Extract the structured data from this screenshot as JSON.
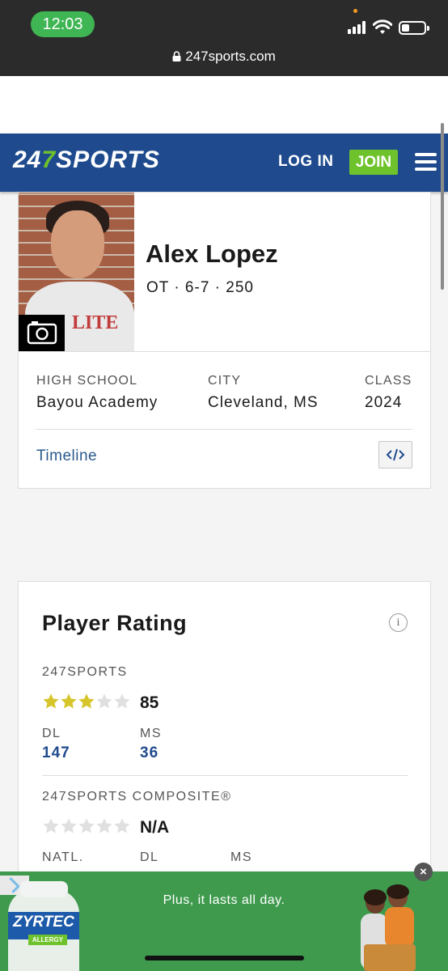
{
  "status_bar": {
    "time": "12:03",
    "url": "247sports.com"
  },
  "header": {
    "logo_number_a": "24",
    "logo_number_b": "7",
    "logo_word": "SPORTS",
    "login_label": "LOG IN",
    "join_label": "JOIN",
    "accent_color": "#6ec22c",
    "brand_color": "#1f4b8e"
  },
  "player": {
    "name": "Alex Lopez",
    "position_line": "OT · 6-7 · 250",
    "shirt_text": "LITE",
    "details": [
      {
        "label": "HIGH SCHOOL",
        "value": "Bayou Academy"
      },
      {
        "label": "CITY",
        "value": "Cleveland, MS"
      },
      {
        "label": "CLASS",
        "value": "2024"
      }
    ],
    "timeline_label": "Timeline",
    "embed_icon": "code-icon"
  },
  "rating": {
    "title": "Player Rating",
    "info_icon_text": "i",
    "sports247": {
      "label": "247SPORTS",
      "stars_filled": 3,
      "stars_total": 5,
      "score": "85",
      "ranks": [
        {
          "label": "DL",
          "value": "147"
        },
        {
          "label": "MS",
          "value": "36"
        }
      ]
    },
    "composite": {
      "label": "247SPORTS COMPOSITE®",
      "stars_filled": 0,
      "stars_total": 5,
      "score": "N/A",
      "ranks": [
        {
          "label": "NATL.",
          "value": ""
        },
        {
          "label": "DL",
          "value": ""
        },
        {
          "label": "MS",
          "value": ""
        }
      ]
    }
  },
  "ad": {
    "tagline": "Plus, it lasts all day.",
    "brand": "ZYRTEC",
    "sub_brand": "ALLERGY",
    "close_text": "×"
  }
}
